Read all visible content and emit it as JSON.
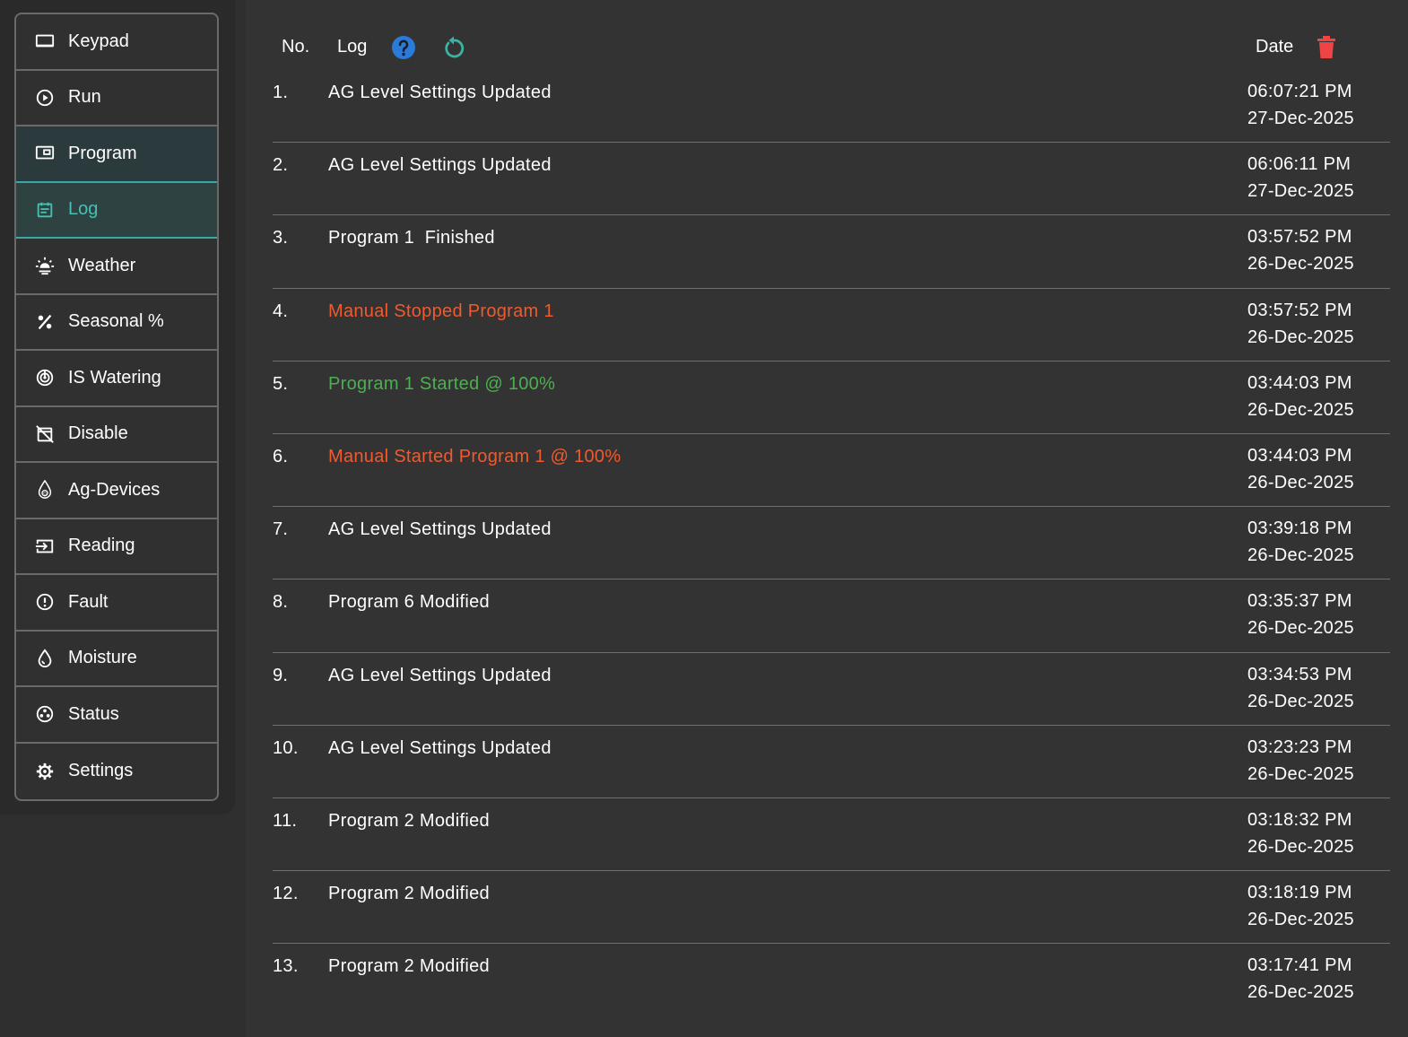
{
  "sidebar": {
    "items": [
      {
        "label": "Keypad",
        "icon": "keyboard-icon"
      },
      {
        "label": "Run",
        "icon": "play-circle-icon"
      },
      {
        "label": "Program",
        "icon": "program-icon"
      },
      {
        "label": "Log",
        "icon": "calendar-log-icon"
      },
      {
        "label": "Weather",
        "icon": "sun-icon"
      },
      {
        "label": "Seasonal %",
        "icon": "percent-icon"
      },
      {
        "label": "IS Watering",
        "icon": "target-icon"
      },
      {
        "label": "Disable",
        "icon": "calendar-off-icon"
      },
      {
        "label": "Ag-Devices",
        "icon": "ag-device-drop-icon"
      },
      {
        "label": "Reading",
        "icon": "input-icon"
      },
      {
        "label": "Fault",
        "icon": "alert-circle-icon"
      },
      {
        "label": "Moisture",
        "icon": "drop-icon"
      },
      {
        "label": "Status",
        "icon": "status-icon"
      },
      {
        "label": "Settings",
        "icon": "gear-icon"
      }
    ],
    "active": "Log"
  },
  "log": {
    "header": {
      "no_label": "No.",
      "log_label": "Log",
      "date_label": "Date"
    },
    "colors": {
      "orange": "#f05a2e",
      "green": "#4cb050",
      "help": "#2a7ad8",
      "refresh": "#3ab2a4",
      "delete": "#ef4444"
    },
    "rows": [
      {
        "no": "1.",
        "message": "AG Level Settings Updated",
        "time": "06:07:21 PM",
        "date": "27-Dec-2025",
        "tone": "white"
      },
      {
        "no": "2.",
        "message": "AG Level Settings Updated",
        "time": "06:06:11 PM",
        "date": "27-Dec-2025",
        "tone": "white"
      },
      {
        "no": "3.",
        "message": "Program 1  Finished",
        "time": "03:57:52 PM",
        "date": "26-Dec-2025",
        "tone": "white"
      },
      {
        "no": "4.",
        "message": "Manual Stopped Program 1",
        "time": "03:57:52 PM",
        "date": "26-Dec-2025",
        "tone": "orange"
      },
      {
        "no": "5.",
        "message": "Program 1 Started @ 100%",
        "time": "03:44:03 PM",
        "date": "26-Dec-2025",
        "tone": "green"
      },
      {
        "no": "6.",
        "message": "Manual Started Program 1 @ 100%",
        "time": "03:44:03 PM",
        "date": "26-Dec-2025",
        "tone": "orange"
      },
      {
        "no": "7.",
        "message": "AG Level Settings Updated",
        "time": "03:39:18 PM",
        "date": "26-Dec-2025",
        "tone": "white"
      },
      {
        "no": "8.",
        "message": "Program 6 Modified",
        "time": "03:35:37 PM",
        "date": "26-Dec-2025",
        "tone": "white"
      },
      {
        "no": "9.",
        "message": "AG Level Settings Updated",
        "time": "03:34:53 PM",
        "date": "26-Dec-2025",
        "tone": "white"
      },
      {
        "no": "10.",
        "message": "AG Level Settings Updated",
        "time": "03:23:23 PM",
        "date": "26-Dec-2025",
        "tone": "white"
      },
      {
        "no": "11.",
        "message": "Program 2 Modified",
        "time": "03:18:32 PM",
        "date": "26-Dec-2025",
        "tone": "white"
      },
      {
        "no": "12.",
        "message": "Program 2 Modified",
        "time": "03:18:19 PM",
        "date": "26-Dec-2025",
        "tone": "white"
      },
      {
        "no": "13.",
        "message": "Program 2 Modified",
        "time": "03:17:41 PM",
        "date": "26-Dec-2025",
        "tone": "white"
      }
    ]
  }
}
